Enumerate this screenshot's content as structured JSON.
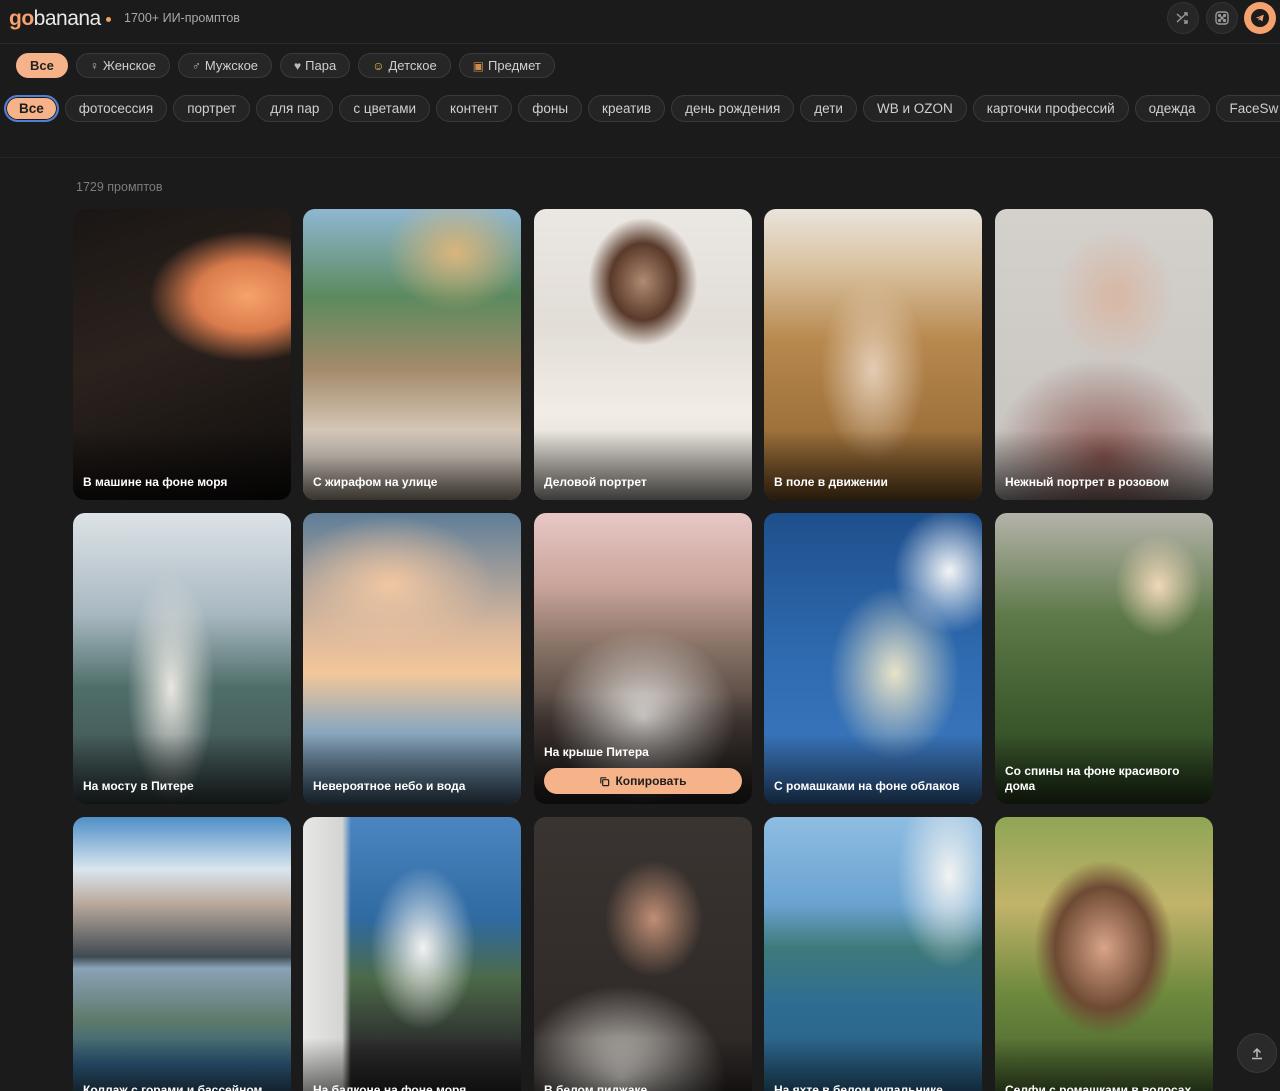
{
  "header": {
    "logo_go": "go",
    "logo_rest": "banana",
    "tagline": "1700+ ИИ-промптов",
    "shuffle_icon": "shuffle-icon",
    "random_icon": "dice-icon",
    "telegram_icon": "telegram-icon"
  },
  "categories": [
    {
      "label": "Все",
      "icon": "",
      "active": true
    },
    {
      "label": "Женское",
      "icon": "♀"
    },
    {
      "label": "Мужское",
      "icon": "♂"
    },
    {
      "label": "Пара",
      "icon": "♥"
    },
    {
      "label": "Детское",
      "icon": "☺"
    },
    {
      "label": "Предмет",
      "icon": "▣"
    }
  ],
  "tags": [
    "Все",
    "фотосессия",
    "портрет",
    "для пар",
    "с цветами",
    "контент",
    "фоны",
    "креатив",
    "день рождения",
    "дети",
    "WB и OZON",
    "карточки профессий",
    "одежда",
    "FaceSw"
  ],
  "count_label": "1729 промптов",
  "cards": [
    {
      "title": "В машине на фоне моря"
    },
    {
      "title": "С жирафом на улице"
    },
    {
      "title": "Деловой портрет"
    },
    {
      "title": "В поле в движении"
    },
    {
      "title": "Нежный портрет в розовом"
    },
    {
      "title": "На мосту в Питере"
    },
    {
      "title": "Невероятное небо и вода"
    },
    {
      "title": "На крыше Питера",
      "copy_label": "Копировать"
    },
    {
      "title": "С ромашками на фоне облаков"
    },
    {
      "title": "Со спины на фоне красивого дома"
    },
    {
      "title": "Коллаж с горами и бассейном"
    },
    {
      "title": "На балконе на фоне моря"
    },
    {
      "title": "В белом пиджаке"
    },
    {
      "title": "На яхте в белом купальнике"
    },
    {
      "title": "Селфи с ромашками в волосах"
    }
  ],
  "colors": {
    "accent": "#f6b38a",
    "background": "#1b1b1c"
  }
}
